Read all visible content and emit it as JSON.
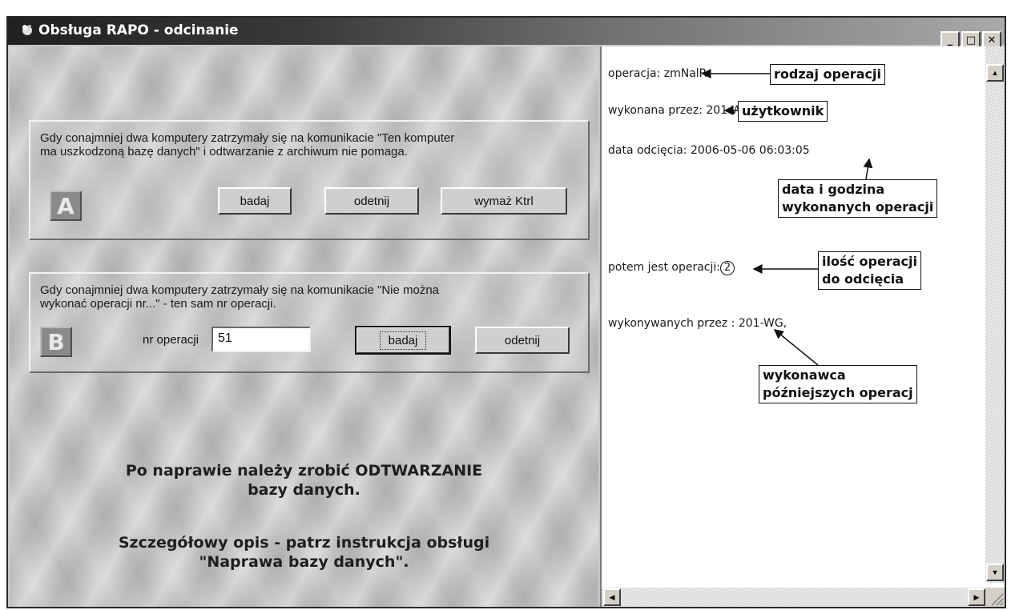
{
  "window": {
    "title": "Obsługa RAPO - odcinanie",
    "icon": "app-icon",
    "controls": {
      "minimize": "_",
      "maximize": "□",
      "close": "✕"
    }
  },
  "section_a": {
    "badge": "A",
    "description_line1": "Gdy conajmniej dwa komputery zatrzymały się na komunikacie \"Ten komputer",
    "description_line2": "ma uszkodzoną bazę danych\" i odtwarzanie z archiwum nie pomaga.",
    "buttons": {
      "check": "badaj",
      "cut": "odetnij",
      "erase": "wymaż Ktrl"
    }
  },
  "section_b": {
    "badge": "B",
    "description_line1": "Gdy conajmniej dwa komputery zatrzymały się na komunikacie \"Nie można",
    "description_line2": "wykonać operacji nr...\" - ten sam nr operacji.",
    "field_label": "nr operacji",
    "field_value": "51",
    "buttons": {
      "check": "badaj",
      "cut": "odetnij"
    }
  },
  "notes": {
    "repair_line1": "Po naprawie należy zrobić ODTWARZANIE",
    "repair_line2": "bazy danych.",
    "details_line1": "Szczegółowy opis - patrz instrukcja obsługi",
    "details_line2": "\"Naprawa bazy danych\"."
  },
  "info_panel": {
    "operation": "operacja: zmNalR",
    "performed_by": "wykonana przez: 201-WG",
    "cut_date": "data odcięcia: 2006-05-06  06:03:05",
    "then_ops_prefix": "potem jest operacji:",
    "then_ops_count": "2",
    "performed_later_by": "wykonywanych przez : 201-WG,"
  },
  "annotations": {
    "operation_type": "rodzaj operacji",
    "user": "użytkownik",
    "date_line1": "data i godzina",
    "date_line2": "wykonanych operacji",
    "count_line1": "ilość operacji",
    "count_line2": "do odcięcia",
    "performer_line1": "wykonawca",
    "performer_line2": "późniejszych operacj"
  }
}
